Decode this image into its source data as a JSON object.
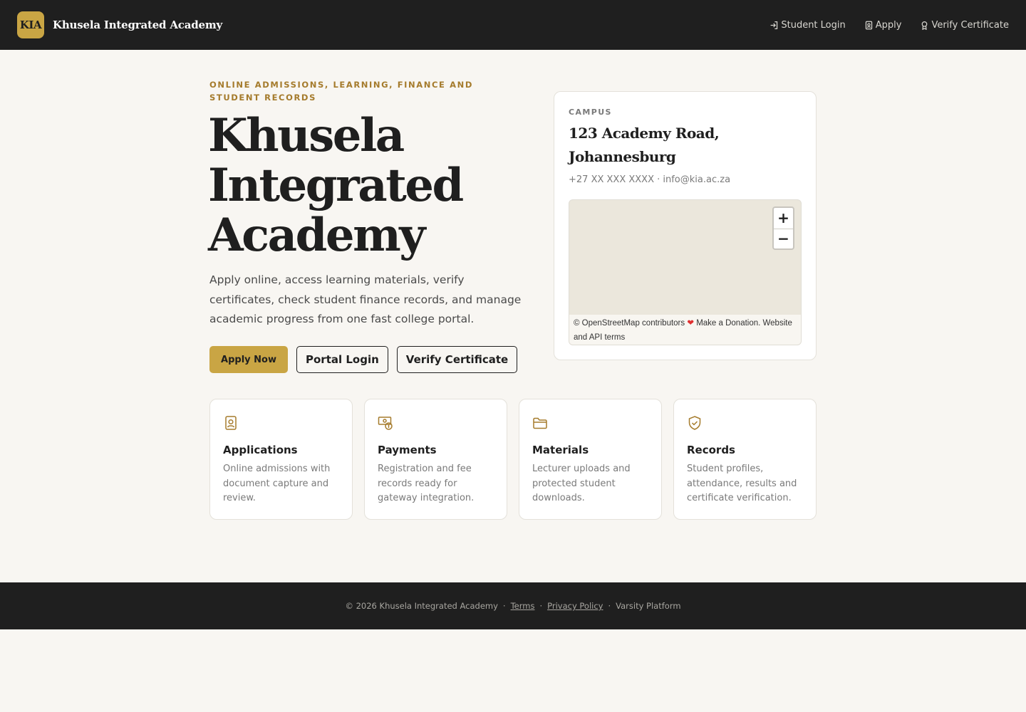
{
  "header": {
    "logo_text": "KIA",
    "brand_name": "Khusela Integrated Academy",
    "nav": [
      {
        "label": "Student Login",
        "icon": "login-icon"
      },
      {
        "label": "Apply",
        "icon": "document-user-icon"
      },
      {
        "label": "Verify Certificate",
        "icon": "award-icon"
      }
    ]
  },
  "hero": {
    "eyebrow": "ONLINE ADMISSIONS, LEARNING, FINANCE AND STUDENT RECORDS",
    "title": "Khusela Integrated Academy",
    "description": "Apply online, access learning materials, verify certificates, check student finance records, and manage academic progress from one fast college portal.",
    "buttons": {
      "apply": "Apply Now",
      "portal": "Portal Login",
      "verify": "Verify Certificate"
    }
  },
  "campus": {
    "label": "CAMPUS",
    "address": "123 Academy Road, Johannesburg",
    "contact": "+27 XX XXX XXXX · info@kia.ac.za",
    "map": {
      "zoom_in": "+",
      "zoom_out": "−",
      "attribution_pre": "© OpenStreetMap contributors",
      "heart": "❤",
      "attribution_post": "Make a Donation. Website and API terms"
    }
  },
  "features": [
    {
      "icon": "document-user-icon",
      "title": "Applications",
      "desc": "Online admissions with document capture and review."
    },
    {
      "icon": "money-icon",
      "title": "Payments",
      "desc": "Registration and fee records ready for gateway integration."
    },
    {
      "icon": "folder-icon",
      "title": "Materials",
      "desc": "Lecturer uploads and protected student downloads."
    },
    {
      "icon": "shield-check-icon",
      "title": "Records",
      "desc": "Student profiles, attendance, results and certificate verification."
    }
  ],
  "footer": {
    "copyright": "© 2026 Khusela Integrated Academy",
    "separator": "·",
    "terms": "Terms",
    "privacy": "Privacy Policy",
    "platform": "Varsity Platform"
  },
  "colors": {
    "dark": "#1f1f1f",
    "accent": "#c9a544",
    "accent_text": "#a57b2c",
    "background": "#f8f6f2"
  }
}
